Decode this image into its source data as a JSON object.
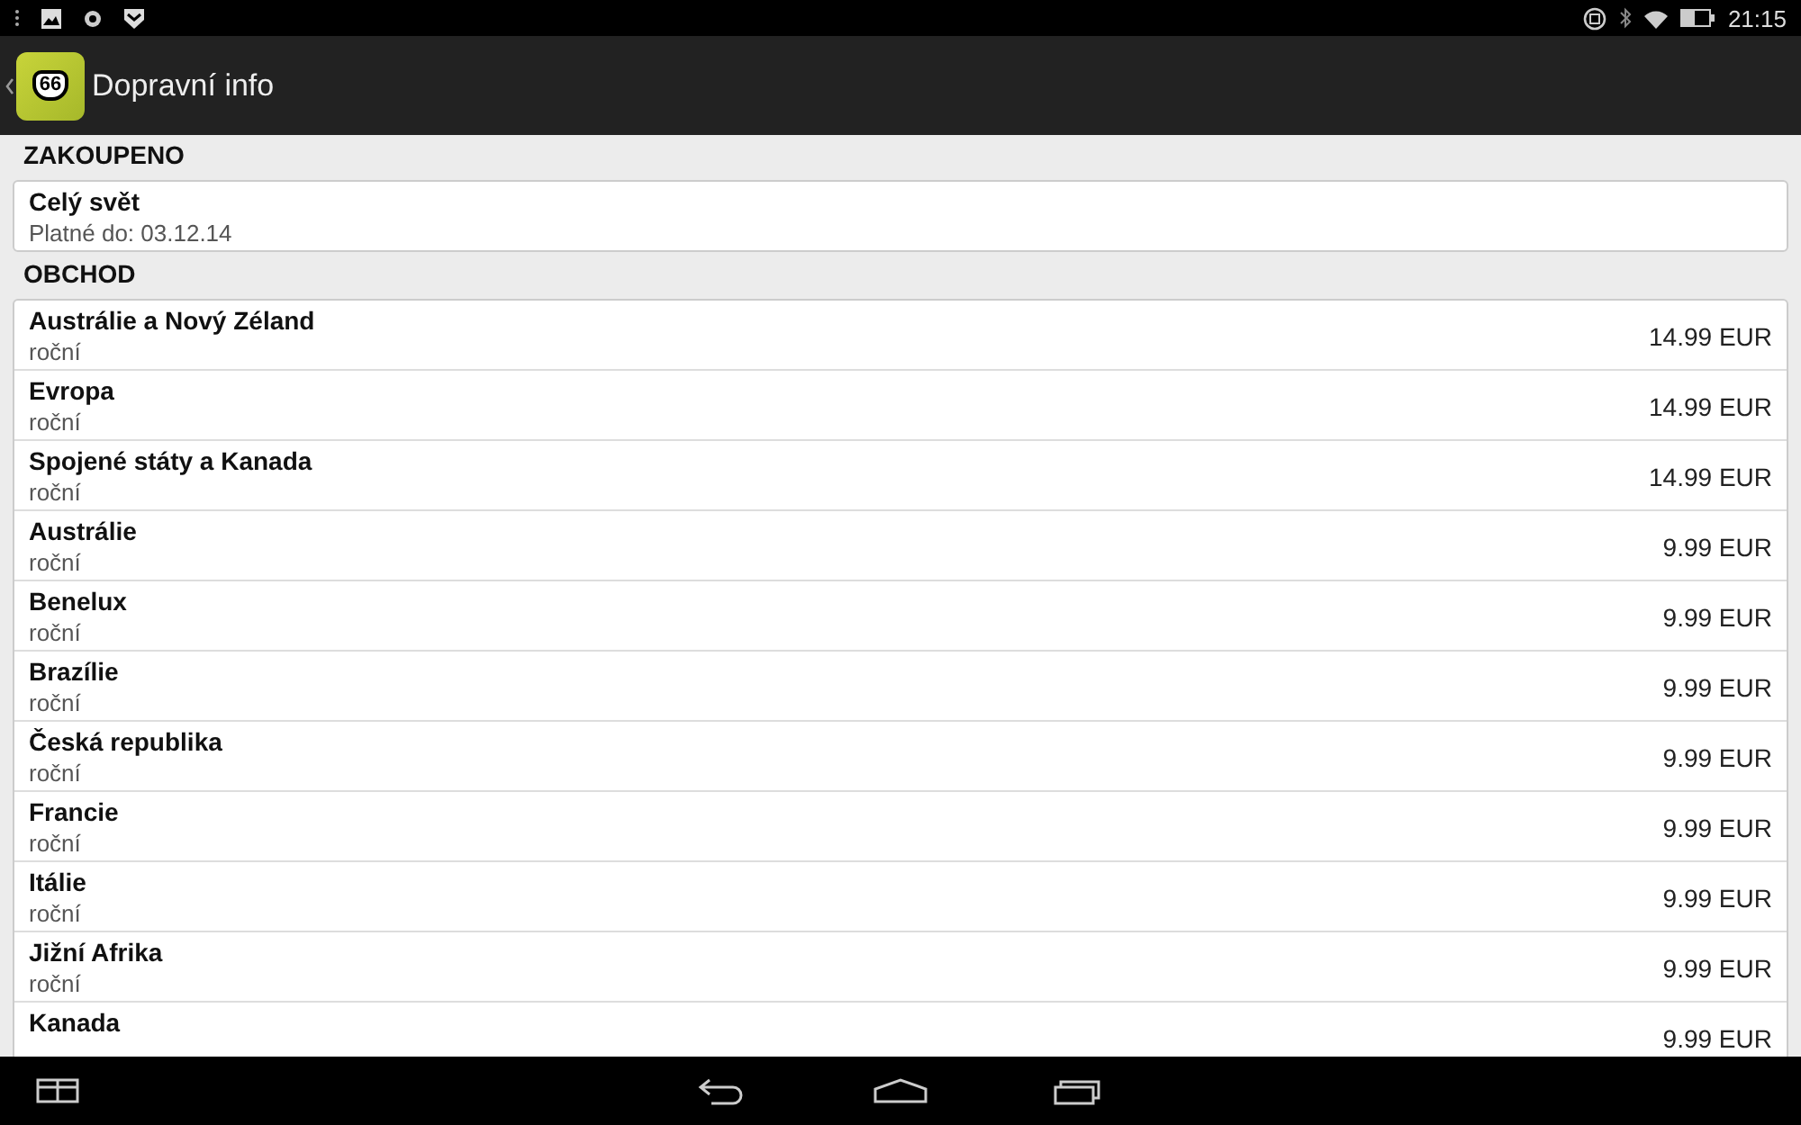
{
  "status_bar": {
    "time": "21:15"
  },
  "app_bar": {
    "title": "Dopravní info",
    "icon_label": "66"
  },
  "purchased": {
    "header": "ZAKOUPENO",
    "items": [
      {
        "name": "Celý svět",
        "detail": "Platné do: 03.12.14"
      }
    ]
  },
  "shop": {
    "header": "OBCHOD",
    "items": [
      {
        "name": "Austrálie a Nový Zéland",
        "detail": "roční",
        "price": "14.99 EUR"
      },
      {
        "name": "Evropa",
        "detail": "roční",
        "price": "14.99 EUR"
      },
      {
        "name": "Spojené státy a Kanada",
        "detail": "roční",
        "price": "14.99 EUR"
      },
      {
        "name": "Austrálie",
        "detail": "roční",
        "price": "9.99 EUR"
      },
      {
        "name": "Benelux",
        "detail": "roční",
        "price": "9.99 EUR"
      },
      {
        "name": "Brazílie",
        "detail": "roční",
        "price": "9.99 EUR"
      },
      {
        "name": "Česká republika",
        "detail": "roční",
        "price": "9.99 EUR"
      },
      {
        "name": "Francie",
        "detail": "roční",
        "price": "9.99 EUR"
      },
      {
        "name": "Itálie",
        "detail": "roční",
        "price": "9.99 EUR"
      },
      {
        "name": "Jižní Afrika",
        "detail": "roční",
        "price": "9.99 EUR"
      },
      {
        "name": "Kanada",
        "price": "9.99 EUR"
      }
    ]
  }
}
